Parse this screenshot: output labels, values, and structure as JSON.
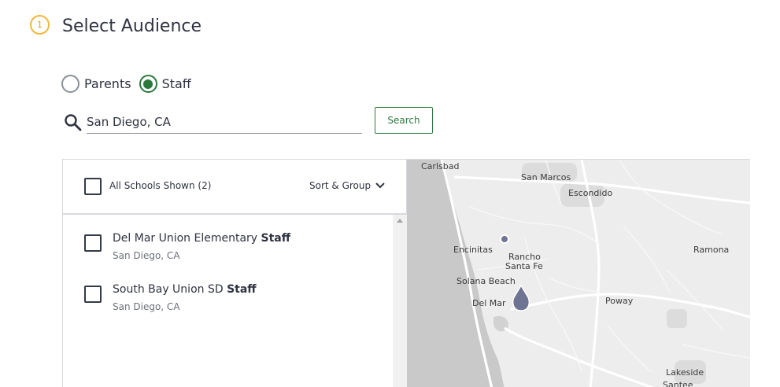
{
  "step": {
    "number": "1",
    "title": "Select Audience"
  },
  "audience": {
    "options": [
      {
        "label": "Parents",
        "selected": false
      },
      {
        "label": "Staff",
        "selected": true
      }
    ]
  },
  "search": {
    "value": "San Diego, CA",
    "button_label": "Search"
  },
  "list": {
    "all_label": "All Schools Shown (2)",
    "sort_label": "Sort & Group",
    "schools": [
      {
        "name": "Del Mar Union Elementary",
        "tag": "Staff",
        "location": "San Diego, CA"
      },
      {
        "name": "South Bay Union SD",
        "tag": "Staff",
        "location": "San Diego, CA"
      }
    ]
  },
  "map": {
    "labels": [
      "Carlsbad",
      "San Marcos",
      "Escondido",
      "Encinitas",
      "Rancho",
      "Santa Fe",
      "Ramona",
      "Solana Beach",
      "Del Mar",
      "Poway",
      "Lakeside",
      "Santee"
    ]
  },
  "colors": {
    "accent": "#2b7a3c",
    "step_badge": "#f3b73c",
    "marker": "#6e7491"
  }
}
